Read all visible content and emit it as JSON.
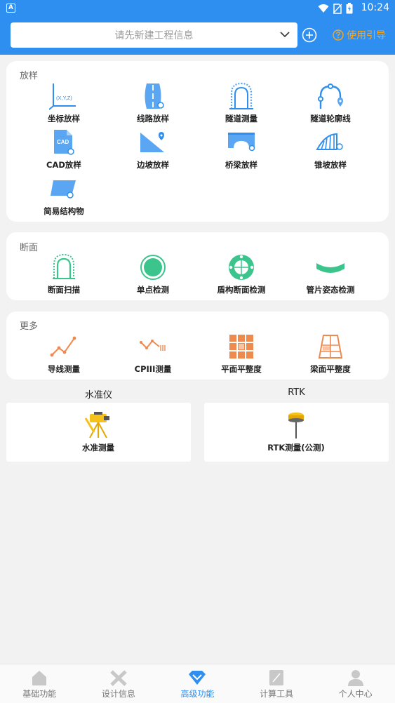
{
  "status": {
    "badge": "A",
    "time": "10:24"
  },
  "header": {
    "project_placeholder": "请先新建工程信息",
    "guide_label": "使用引导"
  },
  "colors": {
    "brand": "#2f8ff0",
    "accent": "#f6a623",
    "green": "#3cc48d",
    "orange": "#ef8a4f"
  },
  "fangyang": {
    "title": "放样",
    "items": [
      {
        "label": "坐标放样",
        "icon": "coordinate-axis-icon"
      },
      {
        "label": "线路放样",
        "icon": "road-route-icon"
      },
      {
        "label": "隧道测量",
        "icon": "tunnel-measure-icon"
      },
      {
        "label": "隧道轮廓线",
        "icon": "tunnel-profile-icon"
      },
      {
        "label": "CAD放样",
        "icon": "cad-file-icon"
      },
      {
        "label": "边坡放样",
        "icon": "slope-icon"
      },
      {
        "label": "桥梁放样",
        "icon": "bridge-icon"
      },
      {
        "label": "锥坡放样",
        "icon": "cone-slope-icon"
      },
      {
        "label": "简易结构物",
        "icon": "simple-structure-icon"
      }
    ],
    "coord_icon_text": "(X,Y,Z)",
    "cad_icon_text": "CAD"
  },
  "duanmian": {
    "title": "断面",
    "items": [
      {
        "label": "断面扫描",
        "icon": "section-scan-icon"
      },
      {
        "label": "单点检测",
        "icon": "single-point-icon"
      },
      {
        "label": "盾构断面检测",
        "icon": "shield-section-icon"
      },
      {
        "label": "管片姿态检测",
        "icon": "segment-attitude-icon"
      }
    ]
  },
  "more": {
    "title": "更多",
    "items": [
      {
        "label": "导线测量",
        "icon": "traverse-icon"
      },
      {
        "label": "CPIII测量",
        "icon": "cpiii-icon"
      },
      {
        "label": "平面平整度",
        "icon": "plane-flatness-icon"
      },
      {
        "label": "梁面平整度",
        "icon": "beam-flatness-icon"
      }
    ]
  },
  "level": {
    "title": "水准仪",
    "item_label": "水准测量"
  },
  "rtk": {
    "title": "RTK",
    "item_label": "RTK测量(公测)"
  },
  "nav": {
    "items": [
      {
        "label": "基础功能",
        "icon": "home-icon",
        "active": false
      },
      {
        "label": "设计信息",
        "icon": "design-tools-icon",
        "active": false
      },
      {
        "label": "高级功能",
        "icon": "diamond-icon",
        "active": true
      },
      {
        "label": "计算工具",
        "icon": "calculator-icon",
        "active": false
      },
      {
        "label": "个人中心",
        "icon": "user-icon",
        "active": false
      }
    ]
  }
}
